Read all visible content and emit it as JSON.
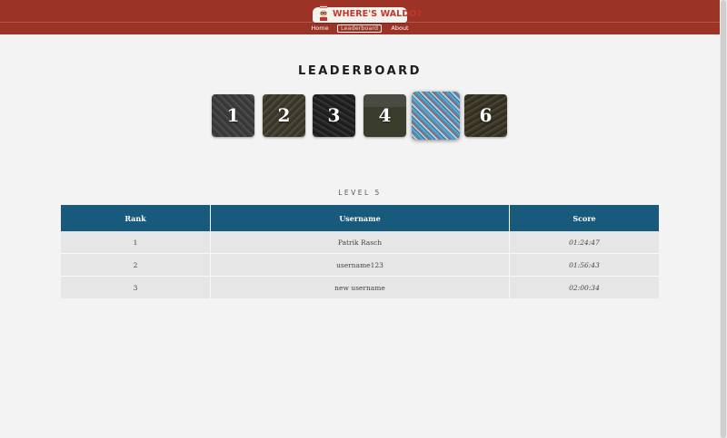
{
  "header": {
    "logo_text": "WHERE'S WALDO?",
    "nav": [
      {
        "label": "Home"
      },
      {
        "label": "Leaderboard",
        "active": true
      },
      {
        "label": "About"
      }
    ]
  },
  "page": {
    "title": "LEADERBOARD",
    "selected_level_label": "LEVEL 5"
  },
  "levels": [
    {
      "label": "1",
      "selected": false
    },
    {
      "label": "2",
      "selected": false
    },
    {
      "label": "3",
      "selected": false
    },
    {
      "label": "4",
      "selected": false
    },
    {
      "label": "",
      "selected": true
    },
    {
      "label": "6",
      "selected": false
    }
  ],
  "table": {
    "headers": [
      "Rank",
      "Username",
      "Score"
    ],
    "rows": [
      {
        "rank": "1",
        "username": "Patrik Rasch",
        "score": "01:24:47"
      },
      {
        "rank": "2",
        "username": "username123",
        "score": "01:56:43"
      },
      {
        "rank": "3",
        "username": "new username",
        "score": "02:00:34"
      }
    ]
  },
  "colors": {
    "header": "#9b3326",
    "table_header": "#175a7c",
    "row": "#e6e6e6"
  }
}
